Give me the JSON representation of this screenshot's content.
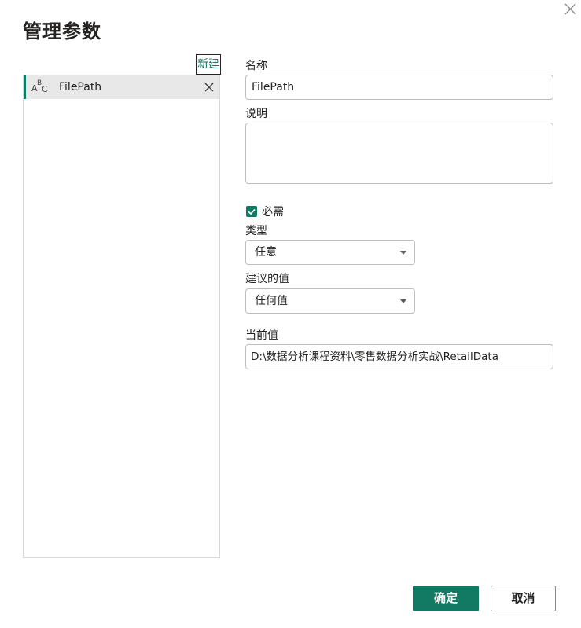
{
  "dialog": {
    "title": "管理参数",
    "new_label": "新建",
    "ok_label": "确定",
    "cancel_label": "取消"
  },
  "parameters": [
    {
      "name": "FilePath",
      "type_icon": "abc-text-icon"
    }
  ],
  "form": {
    "name_label": "名称",
    "name_value": "FilePath",
    "description_label": "说明",
    "description_value": "",
    "required_label": "必需",
    "required_checked": true,
    "type_label": "类型",
    "type_value": "任意",
    "suggested_label": "建议的值",
    "suggested_value": "任何值",
    "current_label": "当前值",
    "current_value": "D:\\数据分析课程资料\\零售数据分析实战\\RetailData"
  },
  "colors": {
    "accent": "#127a63",
    "link": "#0e6e57",
    "selected_bg": "#e8e8e8"
  }
}
